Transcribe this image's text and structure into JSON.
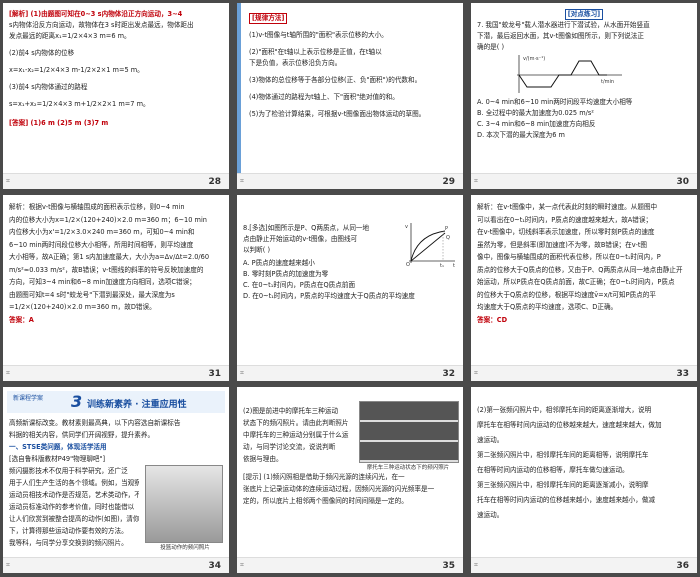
{
  "slides": [
    {
      "page": "28",
      "lines": [
        "[解析]  (1)由题图可知在0~3 s内物体沿正方向运动，3~4",
        "s内物体沿反方向运动，故物体在3 s时距出发点最远，物体距出",
        "发点最远的距离x₁=1/2×4×3 m=6 m。",
        "(2)前4 s内物体的位移",
        "x=x₁-x₂=1/2×4×3 m-1/2×2×1 m=5 m。",
        "(3)前4 s内物体通过的路程",
        "s=x₁+x₂=1/2×4×3 m+1/2×2×1 m=7 m。",
        "[答案]  (1)6 m   (2)5 m   (3)7 m"
      ]
    },
    {
      "page": "29",
      "tag": "[规律方法]",
      "lines": [
        "(1)v-t图像与t轴所围的\"面积\"表示位移的大小。",
        "(2)\"面积\"在t轴以上表示位移是正值，在t轴以",
        "下是负值，表示位移沿负方向。",
        "(3)物体的总位移等于各部分位移(正、负\"面积\")的代数和。",
        "(4)物体通过的路程为t轴上、下\"面积\"绝对值的和。",
        "(5)为了检验计算结果，可根据v-t图像面出物体运动的草图。"
      ]
    },
    {
      "page": "30",
      "tag": "[对点练习]",
      "lines": [
        "7. 我国\"蛟龙号\"载人潜水器进行下潜试验，从水面开始竖直",
        "下潜，最后返回水面，其v-t图像如图所示，则下列说法正",
        "确的是(    )",
        "A. 0~4 min和6~10 min两时间段平均速度大小相等",
        "B. 全过程中的最大加速度为0.025 m/s²",
        "C. 3~4 min和6~8 min加速度方向相反",
        "D. 本次下潜的最大深度为6 m"
      ],
      "graph_ylabel": "v/(m·s⁻¹)",
      "graph_xlabel": "t/min"
    },
    {
      "page": "31",
      "lines": [
        "解析：根据v-t图像与横轴围成的面积表示位移，则0~4 min",
        "内的位移大小为x=1/2×(120+240)×2.0 m=360 m；6~10 min",
        "内位移大小为x'=1/2×3.0×240 m=360 m，可知0~4 min和",
        "6~10 min两时间段位移大小相等，所用时间相等，则平均速度",
        "大小相等，故A正确；第1 s内加速度最大，大小为a=Δv/Δt=2.0/60",
        "m/s²≈0.033 m/s²，故B错误；v-t图线的斜率的符号反映加速度的",
        "方向，可知3~4 min和6~8 min加速度方向相同，选项C错误；",
        "由题图可知t=4 s时\"蛟龙号\"下潜到最深处，最大深度为s",
        "=1/2×(120+240)×2.0 m=360 m，故D错误。",
        "答案：A"
      ]
    },
    {
      "page": "32",
      "lines": [
        "8.[多选]如图所示是P、Q两质点，从同一地",
        "点由静止开始运动的v-t图像，由图线可",
        "以判断(    )",
        "A. P质点的速度越来越小",
        "B. 零时刻P质点的加速度为零",
        "C. 在0~t₁时间内，P质点在Q质点前面",
        "D. 在0~t₁时间内，P质点的平均速度大于Q质点的平均速度"
      ],
      "graph_labels": [
        "v",
        "P",
        "Q",
        "O",
        "t₁",
        "t"
      ]
    },
    {
      "page": "33",
      "lines": [
        "解析：在v-t图像中，某一点代表此时刻的瞬时速度。从题图中",
        "可以看出在0~t₁时间内，P质点的速度越来越大，故A错误；",
        "在v-t图像中，切线斜率表示加速度，所以零时刻P质点的速度",
        "虽然为零，但是斜率(即加速度)不为零，故B错误；在v-t图",
        "像中，图像与横轴围成的面积代表位移，所以在0~t₁时间内，P",
        "质点的位移大于Q质点的位移，又由于P、Q两质点从同一地点由静止开",
        "始运动，所以P质点在Q质点前面，故C正确；在0~t₁时间内，P质点",
        "的位移大于Q质点的位移，根据平均速度v̄=x/t可知P质点的平",
        "均速度大于Q质点的平均速度，选项C、D正确。",
        "答案：CD"
      ]
    },
    {
      "page": "34",
      "banner_small": "新课程学案",
      "banner_num": "3",
      "banner_title": "训练新素养 · 注重应用性",
      "lines": [
        "高频新课标改变。教材素则最高典，以下内容选自新课标告",
        "料据的相关内容，供同学们开阔视野，提升素养。",
        "一、STSE类问题，体现活学活用",
        "[选自鲁科版教材P49\"物理聊吧\"]",
        "频闪摄影技术不仅用于科学研究，还广泛",
        "用于人们生产生活的各个领域。例如，当观察",
        "运动员相技术动作是否规范，艺术类动作，不能",
        "运动员标准动作的参考价值，同时也能借以",
        "让人们欣赏到被整合提高的动作(如图)，清你一",
        "下，计算得那些运动动作要有效的方法。",
        "我等科，与同学分享交换到的频闪照片。"
      ],
      "caption": "投篮动作的频闪照片"
    },
    {
      "page": "35",
      "lines": [
        "(2)图是前进中的摩托车三种运动",
        "状态下的频闪照片。请由此判断照片",
        "中摩托车的三种运动分别属于什么运",
        "动，与同学讨论交流，说说判断",
        "依据与理由。",
        "[提示]  (1)频闪照相是借助于频闪光源的连续闪光，在一",
        "张底片上记录运动体的连续运动过程，因频闪光源的闪光频率是一",
        "定的，所以底片上相邻两个图像间的时间间隔是一定的。"
      ],
      "caption": "摩托车三种运动状态下的频闪照片"
    },
    {
      "page": "36",
      "lines": [
        "(2)第一张频闪照片中，相邻摩托车间的距离逐渐增大，说明",
        "摩托车在相等时间内运动的位移越来越大，速度越来越大，做加",
        "速运动。",
        "第二张频闪照片中，相邻摩托车间的距离相等，说明摩托车",
        "在相等时间内运动的位移相等，摩托车做匀速运动。",
        "第三张频闪照片中，相邻摩托车间的距离逐渐减小，说明摩",
        "托车在相等时间内运动的位移越来越小，速度越来越小，做减",
        "速运动。"
      ]
    }
  ]
}
